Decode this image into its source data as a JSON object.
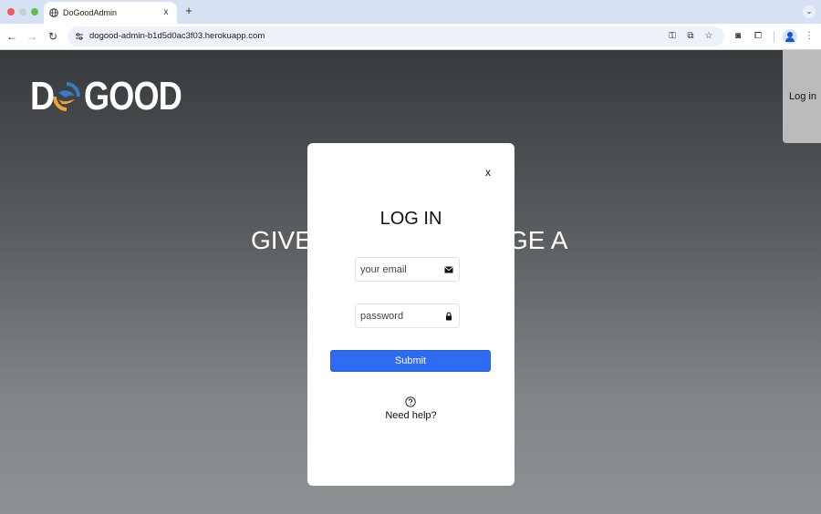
{
  "browser": {
    "tab_title": "DoGoodAdmin",
    "tab_close": "x",
    "new_tab": "+",
    "url": "dogood-admin-b1d5d0ac3f03.herokuapp.com"
  },
  "page": {
    "logo_left": "D",
    "logo_right": "GOOD",
    "hero_left": "GIVE",
    "hero_right": "GE A",
    "login_tab": "Log in"
  },
  "modal": {
    "close": "x",
    "title": "LOG IN",
    "email_placeholder": "your email",
    "password_placeholder": "password",
    "submit": "Submit",
    "help": "Need help?"
  },
  "colors": {
    "accent": "#2e6bf0",
    "logo_blue": "#3a7bc2",
    "logo_orange": "#f0a23a"
  }
}
